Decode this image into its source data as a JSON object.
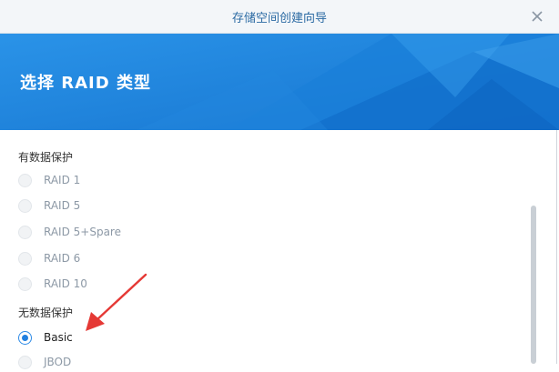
{
  "window": {
    "title": "存储空间创建向导",
    "close_icon": "close-icon"
  },
  "banner": {
    "title": "选择 RAID 类型",
    "color": "#1f84dc"
  },
  "sections": {
    "protected_label": "有数据保护",
    "unprotected_label": "无数据保护"
  },
  "options": [
    {
      "label": "RAID 1",
      "selected": false,
      "enabled": false
    },
    {
      "label": "RAID 5",
      "selected": false,
      "enabled": false
    },
    {
      "label": "RAID 5+Spare",
      "selected": false,
      "enabled": false
    },
    {
      "label": "RAID 6",
      "selected": false,
      "enabled": false
    },
    {
      "label": "RAID 10",
      "selected": false,
      "enabled": false
    },
    {
      "label": "Basic",
      "selected": true,
      "enabled": true
    },
    {
      "label": "JBOD",
      "selected": false,
      "enabled": false
    }
  ],
  "annotation": {
    "arrow_color": "#e53935",
    "points_to": "Basic"
  }
}
